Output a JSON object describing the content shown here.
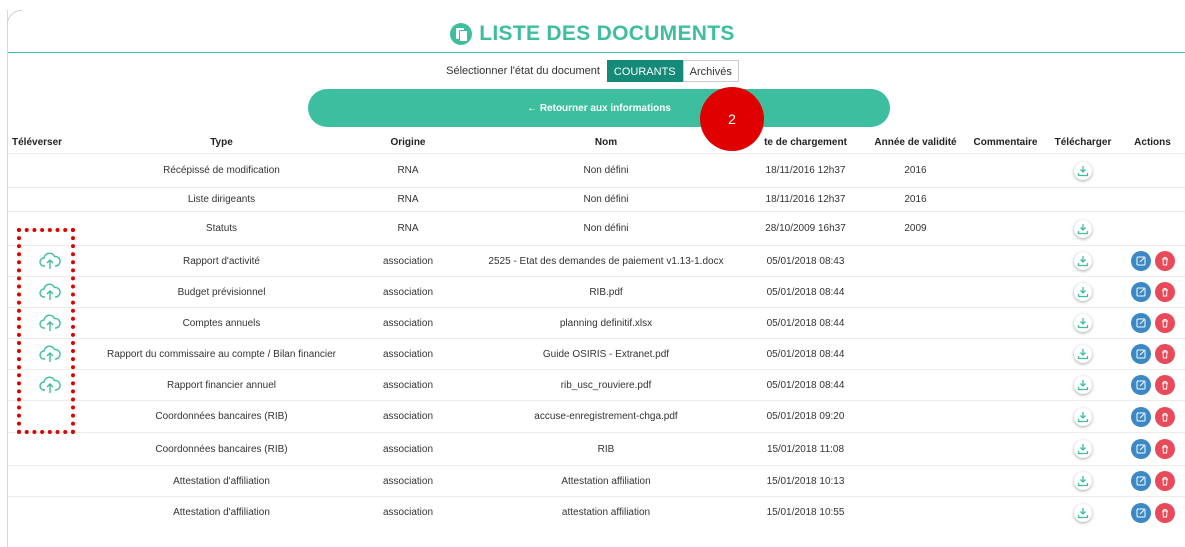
{
  "page": {
    "title": "LISTE DES DOCUMENTS",
    "state_label": "Sélectionner l'état du document",
    "state_options": [
      "COURANTS",
      "Archivés"
    ],
    "return_button": "← Retourner aux informations",
    "step_badge": "2"
  },
  "colors": {
    "accent": "#3dbf9f",
    "accent_dark": "#168a78",
    "badge": "#e00000",
    "edit": "#3a88c4",
    "delete": "#e84a5a"
  },
  "table": {
    "headers": [
      "Téléverser",
      "Type",
      "Origine",
      "Nom",
      "te de chargement",
      "Année de validité",
      "Commentaire",
      "Télécharger",
      "Actions"
    ],
    "rows": [
      {
        "type": "Récépissé de modification",
        "origin": "RNA",
        "name": "Non défini",
        "date": "18/11/2016 12h37",
        "year": "2016",
        "comment": "",
        "upload": false,
        "download": true,
        "actions": false
      },
      {
        "type": "Liste dirigeants",
        "origin": "RNA",
        "name": "Non défini",
        "date": "18/11/2016 12h37",
        "year": "2016",
        "comment": "",
        "upload": false,
        "download": false,
        "actions": false
      },
      {
        "type": "Statuts",
        "origin": "RNA",
        "name": "Non défini",
        "date": "28/10/2009 16h37",
        "year": "2009",
        "comment": "",
        "upload": false,
        "download": true,
        "actions": false
      },
      {
        "type": "Rapport d'activité",
        "origin": "association",
        "name": "2525 - Etat des demandes de paiement v1.13-1.docx",
        "date": "05/01/2018 08:43",
        "year": "",
        "comment": "",
        "upload": true,
        "download": true,
        "actions": true
      },
      {
        "type": "Budget prévisionnel",
        "origin": "association",
        "name": "RIB.pdf",
        "date": "05/01/2018 08:44",
        "year": "",
        "comment": "",
        "upload": true,
        "download": true,
        "actions": true
      },
      {
        "type": "Comptes annuels",
        "origin": "association",
        "name": "planning definitif.xlsx",
        "date": "05/01/2018 08:44",
        "year": "",
        "comment": "",
        "upload": true,
        "download": true,
        "actions": true
      },
      {
        "type": "Rapport du commissaire au compte / Bilan financier",
        "origin": "association",
        "name": "Guide OSIRIS - Extranet.pdf",
        "date": "05/01/2018 08:44",
        "year": "",
        "comment": "",
        "upload": true,
        "download": true,
        "actions": true
      },
      {
        "type": "Rapport financier annuel",
        "origin": "association",
        "name": "rib_usc_rouviere.pdf",
        "date": "05/01/2018 08:44",
        "year": "",
        "comment": "",
        "upload": true,
        "download": true,
        "actions": true
      },
      {
        "type": "Coordonnées bancaires (RIB)",
        "origin": "association",
        "name": "accuse-enregistrement-chga.pdf",
        "date": "05/01/2018 09:20",
        "year": "",
        "comment": "",
        "upload": false,
        "download": true,
        "actions": true
      },
      {
        "type": "Coordonnées bancaires (RIB)",
        "origin": "association",
        "name": "RIB",
        "date": "15/01/2018 11:08",
        "year": "",
        "comment": "",
        "upload": false,
        "download": true,
        "actions": true
      },
      {
        "type": "Attestation d'affiliation",
        "origin": "association",
        "name": "Attestation affiliation",
        "date": "15/01/2018 10:13",
        "year": "",
        "comment": "",
        "upload": false,
        "download": true,
        "actions": true
      },
      {
        "type": "Attestation d'affiliation",
        "origin": "association",
        "name": "attestation affiliation",
        "date": "15/01/2018 10:55",
        "year": "",
        "comment": "",
        "upload": false,
        "download": true,
        "actions": true
      }
    ]
  }
}
